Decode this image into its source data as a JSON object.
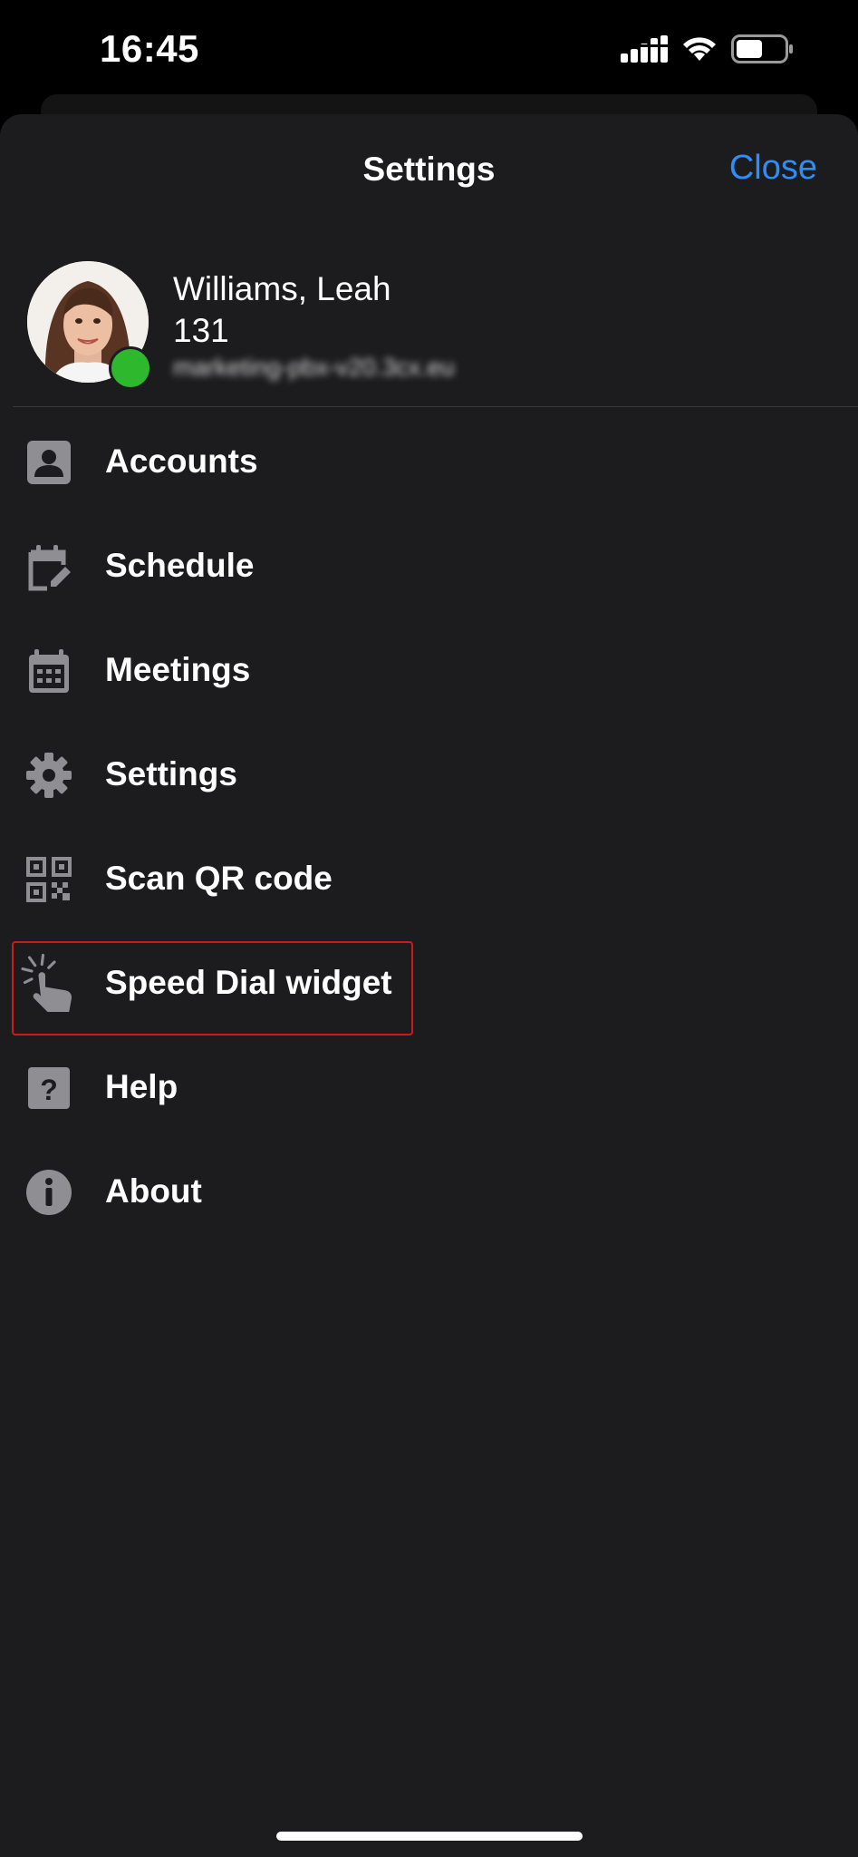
{
  "status_bar": {
    "time": "16:45",
    "icons": [
      "signal-icon",
      "wifi-icon",
      "battery-icon"
    ]
  },
  "sheet": {
    "title": "Settings",
    "close_label": "Close"
  },
  "profile": {
    "name": "Williams, Leah",
    "extension": "131",
    "server": "marketing-pbx-v20.3cx.eu",
    "presence_color": "#2eb82e"
  },
  "menu": {
    "items": [
      {
        "label": "Accounts",
        "icon": "account-icon"
      },
      {
        "label": "Schedule",
        "icon": "schedule-edit-icon"
      },
      {
        "label": "Meetings",
        "icon": "calendar-icon"
      },
      {
        "label": "Settings",
        "icon": "gear-icon"
      },
      {
        "label": "Scan QR code",
        "icon": "qr-code-icon"
      },
      {
        "label": "Speed Dial widget",
        "icon": "tap-hand-icon"
      },
      {
        "label": "Help",
        "icon": "help-icon"
      },
      {
        "label": "About",
        "icon": "info-icon"
      }
    ]
  },
  "colors": {
    "accent": "#2f8ef5",
    "sheet_bg": "#1c1c1e",
    "icon_gray": "#8e8e93",
    "highlight_border": "#c91c1c"
  }
}
